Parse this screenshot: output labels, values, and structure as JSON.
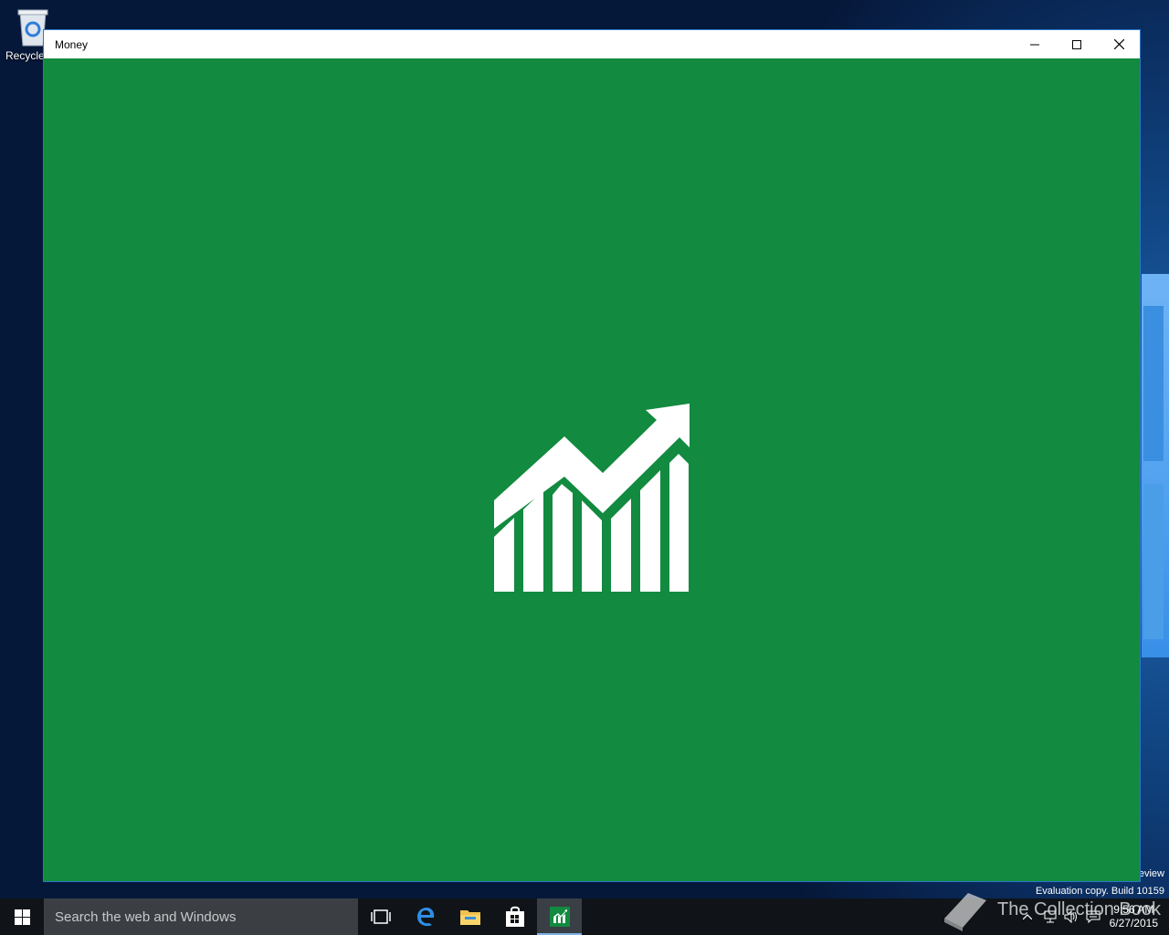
{
  "desktop": {
    "recycle_bin_label": "Recycle"
  },
  "window": {
    "title": "Money",
    "app_icon": "chart-trending-up-icon",
    "accent_color": "#128a3f"
  },
  "watermark": {
    "preview_suffix": "eview",
    "evaluation": "Evaluation copy. Build 10159",
    "collection_book": "The Collection Book"
  },
  "taskbar": {
    "search_placeholder": "Search the web and Windows",
    "pinned": [
      "task-view",
      "edge",
      "file-explorer",
      "store",
      "money"
    ],
    "clock_time": "9:56 AM",
    "clock_date": "6/27/2015"
  }
}
